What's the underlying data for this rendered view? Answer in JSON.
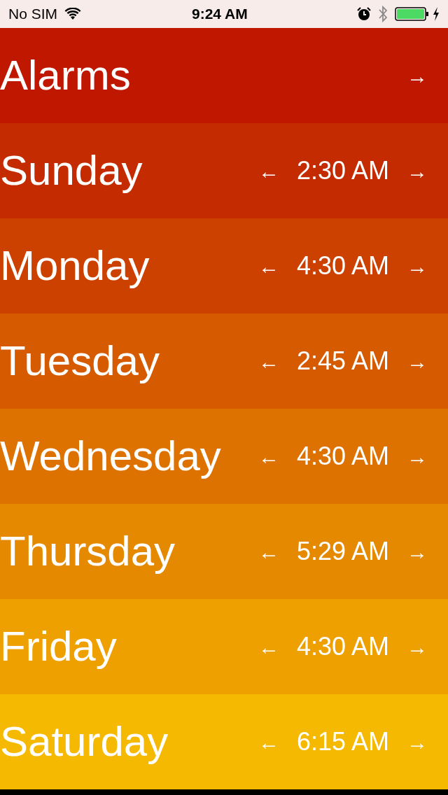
{
  "status_bar": {
    "carrier": "No SIM",
    "time": "9:24 AM"
  },
  "header": {
    "title": "Alarms",
    "next": "→",
    "color": "#c01800"
  },
  "days": [
    {
      "name": "Sunday",
      "prev": "←",
      "time": "2:30 AM",
      "next": "→",
      "color": "#c52b00"
    },
    {
      "name": "Monday",
      "prev": "←",
      "time": "4:30 AM",
      "next": "→",
      "color": "#cc4100"
    },
    {
      "name": "Tuesday",
      "prev": "←",
      "time": "2:45 AM",
      "next": "→",
      "color": "#d55a00"
    },
    {
      "name": "Wednesday",
      "prev": "←",
      "time": "4:30 AM",
      "next": "→",
      "color": "#dd7200"
    },
    {
      "name": "Thursday",
      "prev": "←",
      "time": "5:29 AM",
      "next": "→",
      "color": "#e58900"
    },
    {
      "name": "Friday",
      "prev": "←",
      "time": "4:30 AM",
      "next": "→",
      "color": "#eda000"
    },
    {
      "name": "Saturday",
      "prev": "←",
      "time": "6:15 AM",
      "next": "→",
      "color": "#f4b900"
    }
  ]
}
